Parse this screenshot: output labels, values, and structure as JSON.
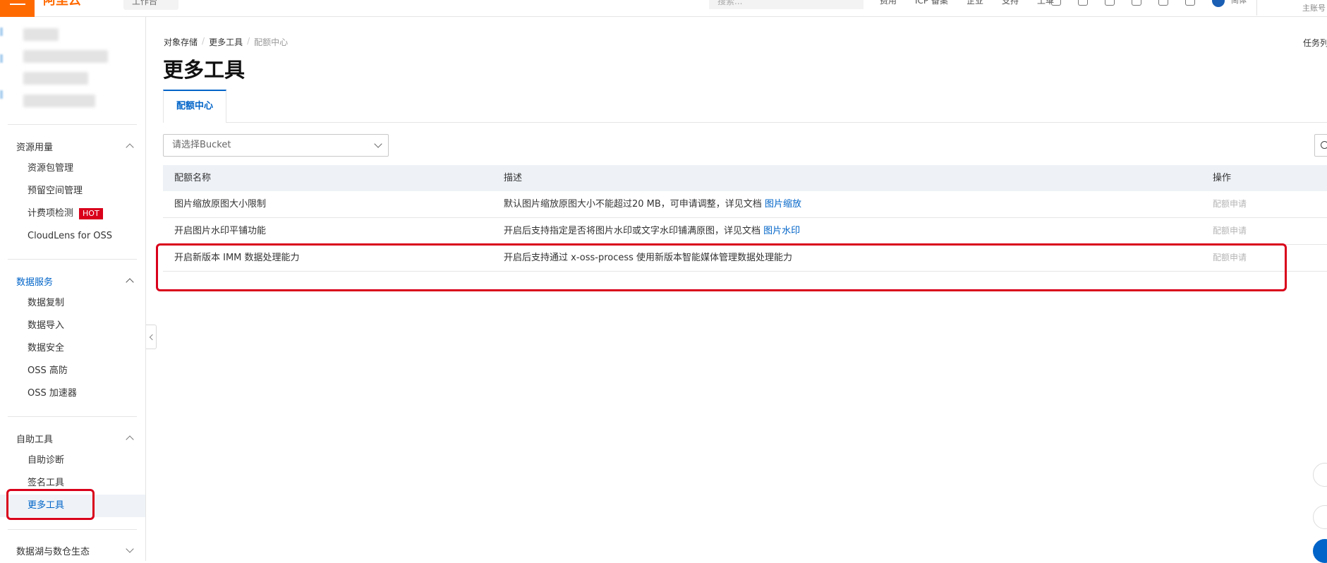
{
  "topbar": {
    "logo_text": "阿里云",
    "workbench": "工作台",
    "search_placeholder": "搜索...",
    "links": [
      "费用",
      "ICP 备案",
      "企业",
      "支持",
      "工单"
    ],
    "user": "简体",
    "account": "主账号"
  },
  "sidebar": {
    "groups": [
      {
        "title": "资源用量",
        "items": [
          "资源包管理",
          "预留空间管理",
          "计费项检测",
          "CloudLens for OSS"
        ],
        "hot_badge": "HOT"
      },
      {
        "title": "数据服务",
        "items": [
          "数据复制",
          "数据导入",
          "数据安全",
          "OSS 高防",
          "OSS 加速器"
        ]
      },
      {
        "title": "自助工具",
        "items": [
          "自助诊断",
          "签名工具",
          "更多工具"
        ]
      },
      {
        "title": "数据湖与数仓生态",
        "items": []
      }
    ]
  },
  "breadcrumb": [
    "对象存储",
    "更多工具",
    "配额中心"
  ],
  "page_title": "更多工具",
  "task_list": "任务列",
  "tabs": [
    "配额中心"
  ],
  "bucket_select": {
    "placeholder": "请选择Bucket"
  },
  "table": {
    "headers": [
      "配额名称",
      "描述",
      "操作"
    ],
    "rows": [
      {
        "name": "图片缩放原图大小限制",
        "desc": "默认图片缩放原图大小不能超过20 MB，可申请调整，详见文档 ",
        "link": "图片缩放",
        "action": "配额申请"
      },
      {
        "name": "开启图片水印平铺功能",
        "desc": "开启后支持指定是否将图片水印或文字水印铺满原图，详见文档 ",
        "link": "图片水印",
        "action": "配额申请"
      },
      {
        "name": "开启新版本 IMM 数据处理能力",
        "desc": "开启后支持通过 x-oss-process 使用新版本智能媒体管理数据处理能力",
        "link": "",
        "action": "配额申请"
      }
    ]
  },
  "colors": {
    "brand": "#ff6a00",
    "accent": "#0064c8",
    "highlight": "#d9001b"
  }
}
